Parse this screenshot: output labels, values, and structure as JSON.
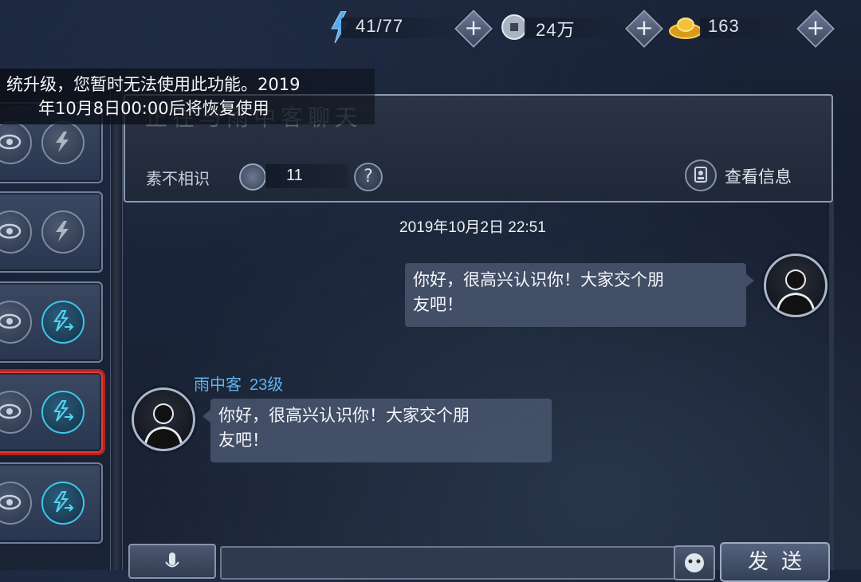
{
  "resources": {
    "energy": {
      "icon": "lightning-icon",
      "value": "41/77"
    },
    "silver": {
      "icon": "coin-icon",
      "value": "24万"
    },
    "gold": {
      "icon": "gold-ingot-icon",
      "value": "163"
    },
    "plus_label": "+"
  },
  "notice": {
    "line1": "统升级，您暂时无法使用此功能。2019",
    "line2": "年10月8日00:00后将恢复使用"
  },
  "friend_list": {
    "items": [
      {
        "action": "gift-disabled"
      },
      {
        "action": "gift-disabled"
      },
      {
        "action": "gift-active"
      },
      {
        "action": "gift-active",
        "selected": true
      },
      {
        "action": "gift-active"
      }
    ]
  },
  "header": {
    "ghost_text": "正在与雨中客聊天",
    "relation": "素不相识",
    "intimacy": "11",
    "help_label": "?",
    "view_info_label": "查看信息"
  },
  "chat": {
    "timestamp": "2019年10月2日 22:51",
    "messages": [
      {
        "from": "me",
        "line1": "你好，很高兴认识你！大家交个朋",
        "line2": "友吧！"
      },
      {
        "from": "other",
        "sender": "雨中客",
        "level": "23级",
        "line1": "你好，很高兴认识你！大家交个朋",
        "line2": "友吧！"
      }
    ]
  },
  "input_bar": {
    "placeholder": "",
    "send_label": "发送"
  },
  "colors": {
    "accent_cyan": "#3fc6e6",
    "sender_blue": "#5fb3ec",
    "selected_red": "#e53a35"
  }
}
